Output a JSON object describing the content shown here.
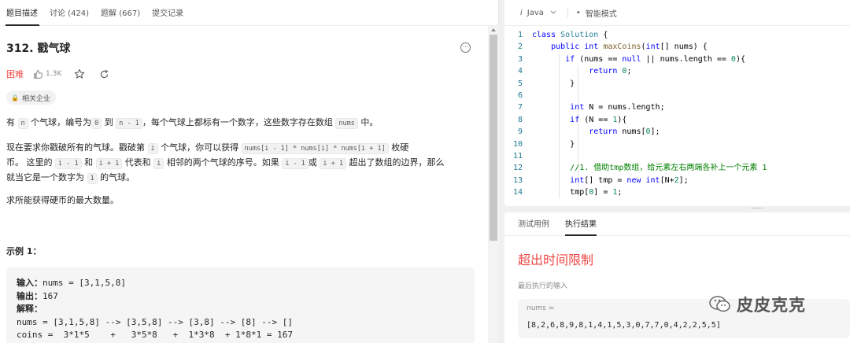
{
  "tabs": [
    "题目描述",
    "讨论 (424)",
    "题解 (667)",
    "提交记录"
  ],
  "problem": {
    "title": "312. 戳气球",
    "difficulty": "困难",
    "likes": "1.3K",
    "company": "相关企业",
    "p1": {
      "a": "有",
      "c1": "n",
      "b": "个气球，编号为",
      "c2": "0",
      "c": "到",
      "c3": "n - 1",
      "d": "，每个气球上都标有一个数字，这些数字存在数组",
      "c4": "nums",
      "e": "中。"
    },
    "p2": {
      "a": "现在要求你戳破所有的气球。戳破第",
      "c1": "i",
      "b": "个气球，你可以获得",
      "c2": "nums[i - 1] * nums[i] * nums[i + 1]",
      "c": "枚硬",
      "d": "币。 这里的",
      "c3": "i - 1",
      "e": "和",
      "c4": "i + 1",
      "f": "代表和",
      "c5": "i",
      "g": "相邻的两个气球的序号。如果",
      "c6": "i - 1",
      "h": "或",
      "c7": "i + 1",
      "i": "超出了数组的边界，那么",
      "j": "就当它是一个数字为",
      "c8": "1",
      "k": "的气球。"
    },
    "p3": "求所能获得硬币的最大数量。",
    "example_title": "示例 1：",
    "ex": {
      "in_label": "输入：",
      "in_val": "nums = [3,1,5,8]",
      "out_label": "输出：",
      "out_val": "167",
      "expl_label": "解释：",
      "l1": "nums = [3,1,5,8] --> [3,5,8] --> [3,8] --> [8] --> []",
      "l2": "coins =  3*1*5    +   3*5*8   +  1*3*8  + 1*8*1 = 167"
    }
  },
  "editor": {
    "lang": "Java",
    "mode": "智能模式",
    "lines": [
      "1",
      "2",
      "3",
      "4",
      "5",
      "6",
      "7",
      "8",
      "9",
      "10",
      "11",
      "12",
      "13",
      "14"
    ]
  },
  "result": {
    "tab_tests": "测试用例",
    "tab_result": "执行结果",
    "status": "超出时间限制",
    "last_input_label": "最后执行的输入",
    "input_name": "nums =",
    "input_value": "[8,2,6,8,9,8,1,4,1,5,3,0,7,7,0,4,2,2,5,5]"
  },
  "watermark": "皮皮克克",
  "colors": {
    "hard": "#ef4743",
    "keyword": "#0000ff",
    "number": "#098658",
    "comment": "#008000"
  }
}
